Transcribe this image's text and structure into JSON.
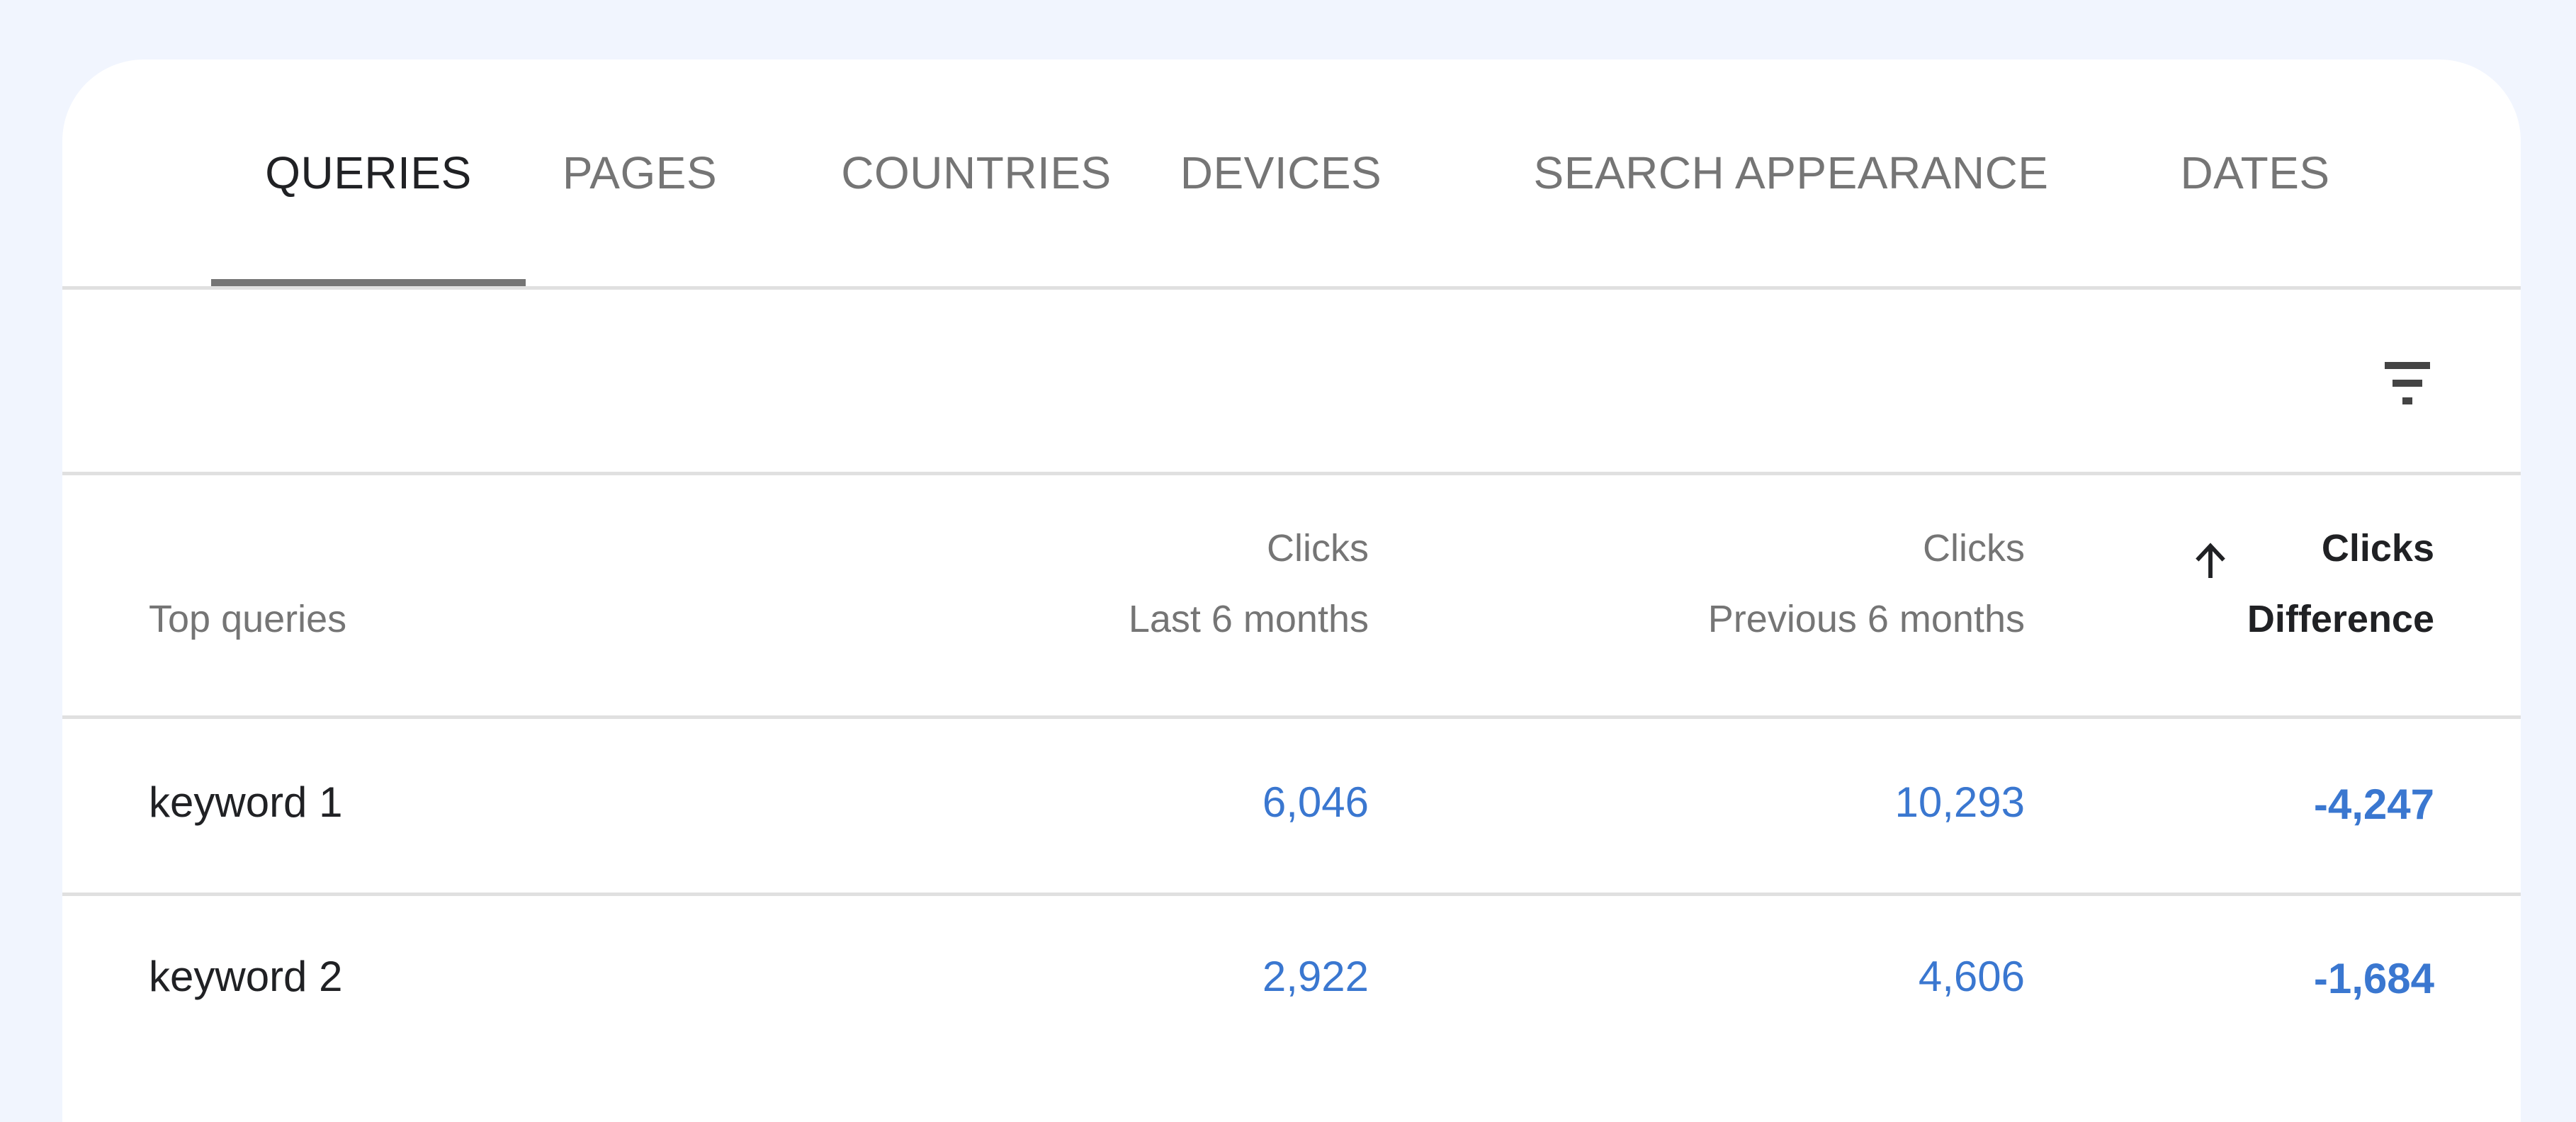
{
  "tabs": [
    {
      "label": "QUERIES",
      "active": true
    },
    {
      "label": "PAGES",
      "active": false
    },
    {
      "label": "COUNTRIES",
      "active": false
    },
    {
      "label": "DEVICES",
      "active": false
    },
    {
      "label": "SEARCH APPEARANCE",
      "active": false
    },
    {
      "label": "DATES",
      "active": false
    }
  ],
  "toolbar": {
    "filter_icon": "filter-list-icon"
  },
  "table": {
    "columns": [
      {
        "line1": "Top queries",
        "line2": ""
      },
      {
        "line1": "Clicks",
        "line2": "Last 6 months"
      },
      {
        "line1": "Clicks",
        "line2": "Previous 6 months"
      },
      {
        "line1": "Clicks",
        "line2": "Difference",
        "sorted": "ascending",
        "sort_icon": "arrow-upward-icon"
      }
    ],
    "rows": [
      {
        "query": "keyword 1",
        "last": "6,046",
        "previous": "10,293",
        "difference": "-4,247"
      },
      {
        "query": "keyword 2",
        "last": "2,922",
        "previous": "4,606",
        "difference": "-1,684"
      }
    ]
  },
  "colors": {
    "background": "#f1f5fe",
    "accent_number": "#3a77d0",
    "active_tab_text": "#202124",
    "inactive_tab_text": "#757575",
    "divider": "#e0e0e0"
  }
}
